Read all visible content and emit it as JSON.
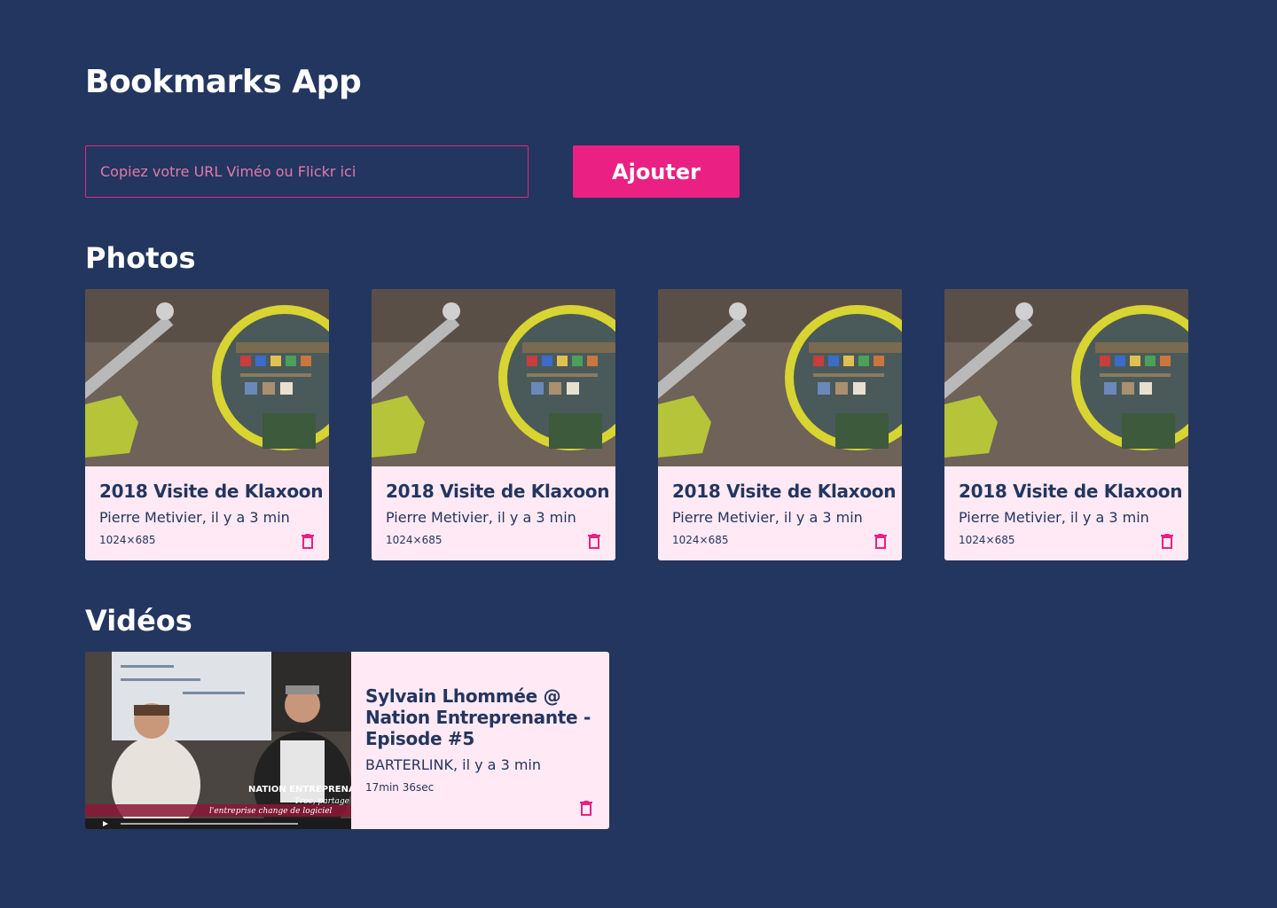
{
  "app": {
    "title": "Bookmarks App"
  },
  "form": {
    "placeholder": "Copiez votre URL Viméo ou Flickr ici",
    "value": "",
    "submit_label": "Ajouter"
  },
  "photos": {
    "section_title": "Photos",
    "items": [
      {
        "title": "2018 Visite de Klaxoon",
        "meta": "Pierre Metivier, il y a 3 min",
        "dimensions": "1024×685"
      },
      {
        "title": "2018 Visite de Klaxoon",
        "meta": "Pierre Metivier, il y a 3 min",
        "dimensions": "1024×685"
      },
      {
        "title": "2018 Visite de Klaxoon",
        "meta": "Pierre Metivier, il y a 3 min",
        "dimensions": "1024×685"
      },
      {
        "title": "2018 Visite de Klaxoon",
        "meta": "Pierre Metivier, il y a 3 min",
        "dimensions": "1024×685"
      }
    ]
  },
  "videos": {
    "section_title": "Vidéos",
    "items": [
      {
        "title": "Sylvain Lhommée @ Nation Entreprenante - Episode #5",
        "meta": "BARTERLINK, il y a 3 min",
        "duration": "17min 36sec",
        "overlay_title": "NATION ENTREPRENANTE",
        "overlay_subtitle_1": "Troc, partage",
        "overlay_subtitle_2": "l'entreprise change de logiciel"
      }
    ]
  },
  "icons": {
    "delete": "trash-icon"
  },
  "colors": {
    "background": "#23365f",
    "accent": "#ea2182",
    "card": "#ffe9f4",
    "text_dark": "#23365f"
  }
}
